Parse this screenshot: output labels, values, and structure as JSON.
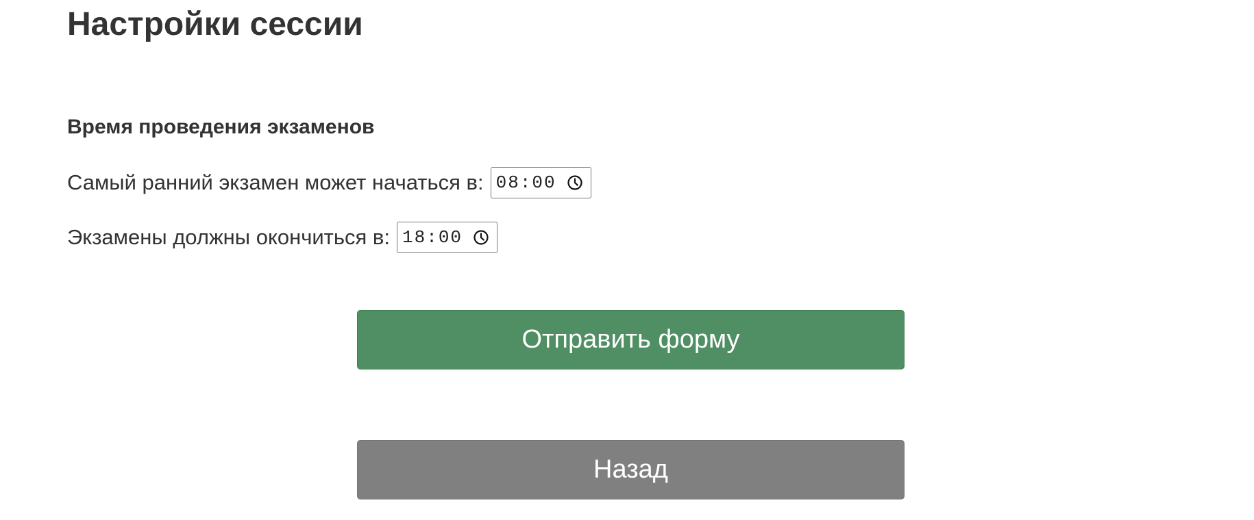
{
  "page": {
    "title": "Настройки сессии"
  },
  "exam_time": {
    "section_title": "Время проведения экзаменов",
    "start": {
      "label": "Самый ранний экзамен может начаться в:",
      "value": "08:00",
      "icon": "clock-icon"
    },
    "end": {
      "label": "Экзамены должны окончиться в:",
      "value": "18:00",
      "icon": "clock-icon"
    }
  },
  "actions": {
    "submit_label": "Отправить форму",
    "back_label": "Назад"
  },
  "colors": {
    "text": "#333333",
    "submit_button": "#4f8f63",
    "back_button": "#808080",
    "button_text": "#ffffff"
  }
}
